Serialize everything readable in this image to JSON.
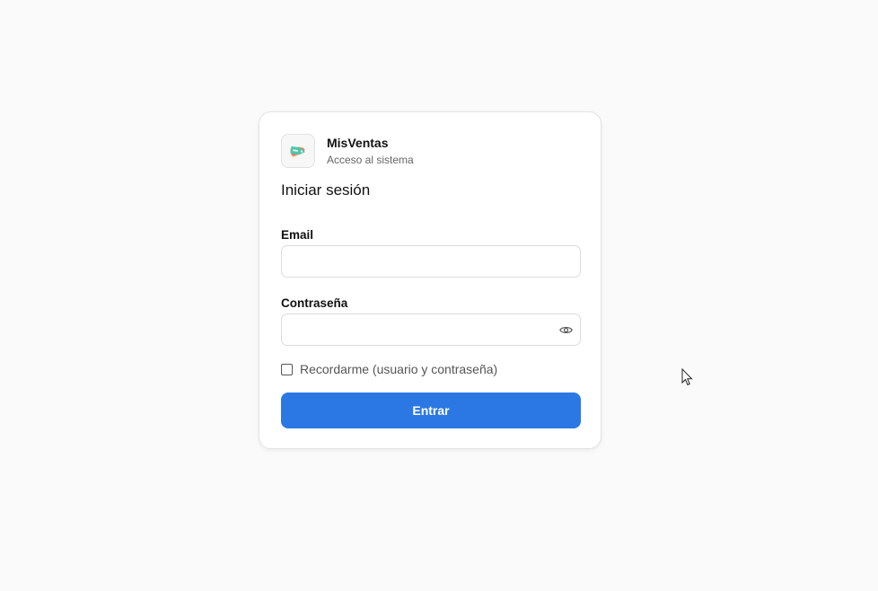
{
  "brand": {
    "name": "MisVentas",
    "subtitle": "Acceso al sistema",
    "logo_icon": "sale-tag-icon"
  },
  "form": {
    "title": "Iniciar sesión",
    "email": {
      "label": "Email",
      "value": "",
      "placeholder": ""
    },
    "password": {
      "label": "Contraseña",
      "value": "",
      "placeholder": "",
      "toggle_icon": "eye-icon"
    },
    "remember": {
      "label": "Recordarme (usuario y contraseña)",
      "checked": false
    },
    "submit_label": "Entrar"
  },
  "colors": {
    "background": "#fafafa",
    "card": "#ffffff",
    "primary": "#2b78e4",
    "border": "#dcdcdc"
  }
}
